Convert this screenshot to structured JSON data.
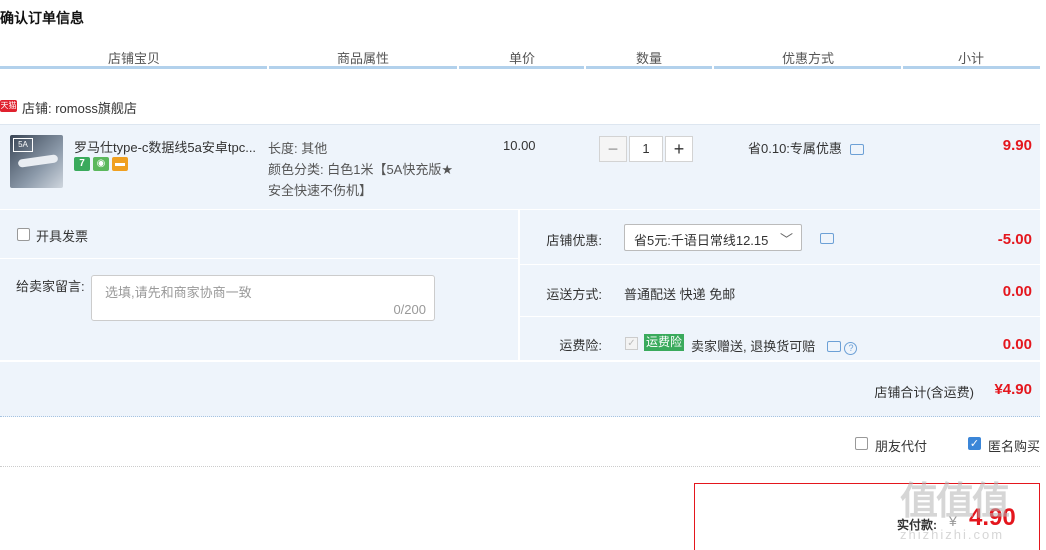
{
  "page": {
    "title": "确认订单信息"
  },
  "table_headers": [
    "店铺宝贝",
    "商品属性",
    "单价",
    "数量",
    "优惠方式",
    "小计"
  ],
  "shop": {
    "badge": "天猫",
    "label": "店铺: romoss旗舰店"
  },
  "item": {
    "thumb_tag": "5A",
    "name": "罗马仕type-c数据线5a安卓tpc...",
    "attr_length": "长度: 其他",
    "attr_color_line1": "颜色分类: 白色1米【5A快充版★",
    "attr_color_line2": "安全快速不伤机】",
    "price": "10.00",
    "quantity": "1",
    "qty_minus": "−",
    "qty_plus": "+",
    "discount": "省0.10:专属优惠",
    "subtotal": "9.90"
  },
  "invoice": {
    "label": "开具发票",
    "checked": false
  },
  "message": {
    "label": "给卖家留言:",
    "placeholder": "选填,请先和商家协商一致",
    "count": "0/200"
  },
  "store_discount": {
    "label": "店铺优惠:",
    "selected": "省5元:千语日常线12.15",
    "value": "-5.00"
  },
  "shipping": {
    "label": "运送方式:",
    "method": "普通配送 快递 免邮",
    "value": "0.00"
  },
  "insurance": {
    "label": "运费险:",
    "badge": "运费险",
    "text": "卖家赠送, 退换货可赔",
    "value": "0.00",
    "help_icon": "?"
  },
  "store_total": {
    "label": "店铺合计(含运费)",
    "value": "¥4.90"
  },
  "options": {
    "friend_pay": "朋友代付",
    "friend_pay_checked": false,
    "anonymous": "匿名购买",
    "anonymous_checked": true
  },
  "payment": {
    "label": "实付款:",
    "currency": "¥",
    "value": "4.90"
  },
  "watermark": {
    "text": "值值值",
    "sub": "zhizhizhi.com"
  },
  "colors": {
    "accent_red": "#e4161d",
    "header_line": "#b2d1ec",
    "panel_bg": "#eef4fb",
    "check_blue": "#3b86d8",
    "insurance_green": "#3aaa5c"
  }
}
